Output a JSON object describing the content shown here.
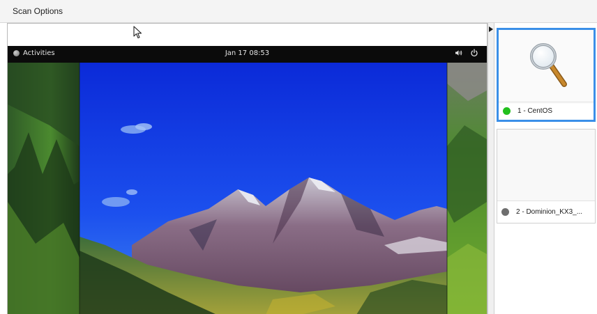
{
  "menubar": {
    "scan_options_label": "Scan Options"
  },
  "remote_desktop": {
    "activities_label": "Activities",
    "clock": "Jan 17  08:53",
    "icons": [
      "volume-icon",
      "power-icon"
    ]
  },
  "targets": [
    {
      "label": "1 - CentOS",
      "status_color": "#22c01e",
      "selected": true,
      "icon": "magnifier-icon"
    },
    {
      "label": "2 - Dominion_KX3_...",
      "status_color": "#6e6e6e",
      "selected": false
    }
  ],
  "colors": {
    "selection_border": "#3a8fe8",
    "remote_topbar": "#0b0b0b"
  }
}
